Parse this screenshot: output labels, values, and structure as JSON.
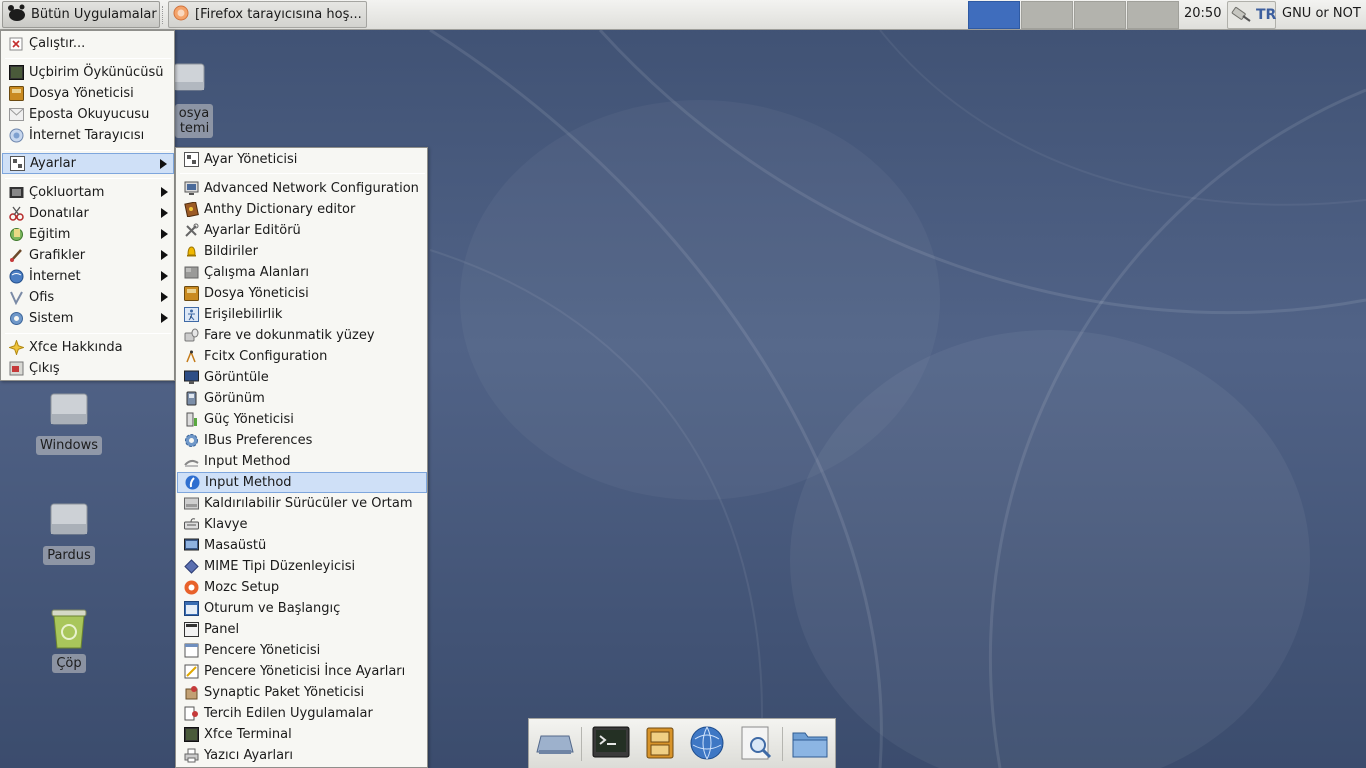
{
  "top_panel": {
    "apps_button": "Bütün Uygulamalar",
    "task_title": "[Firefox tarayıcısına hoş...",
    "clock": "20:50",
    "keyboard_layout": "TR",
    "user": "GNU or NOT"
  },
  "desktop_icons": {
    "file_system": "osya\ntemi",
    "windows": "Windows",
    "pardus": "Pardus",
    "trash": "Çöp"
  },
  "main_menu": {
    "run": "Çalıştır...",
    "terminal": "Uçbirim Öykünücüsü",
    "file_manager": "Dosya Yöneticisi",
    "mail": "Eposta Okuyucusu",
    "browser": "İnternet Tarayıcısı",
    "settings": "Ayarlar",
    "multimedia": "Çokluortam",
    "accessories": "Donatılar",
    "education": "Eğitim",
    "graphics": "Grafikler",
    "internet": "İnternet",
    "office": "Ofis",
    "system": "Sistem",
    "about": "Xfce Hakkında",
    "logout": "Çıkış"
  },
  "settings_menu": {
    "manager": "Ayar Yöneticisi",
    "items": [
      {
        "label": "Advanced Network Configuration",
        "icon": "network-icon"
      },
      {
        "label": "Anthy Dictionary editor",
        "icon": "dictionary-icon"
      },
      {
        "label": "Ayarlar Editörü",
        "icon": "tools-icon"
      },
      {
        "label": "Bildiriler",
        "icon": "bell-icon"
      },
      {
        "label": "Çalışma Alanları",
        "icon": "workspaces-icon"
      },
      {
        "label": "Dosya Yöneticisi",
        "icon": "file-cabinet-icon"
      },
      {
        "label": "Erişilebilirlik",
        "icon": "accessibility-icon"
      },
      {
        "label": "Fare ve dokunmatik yüzey",
        "icon": "mouse-icon"
      },
      {
        "label": "Fcitx Configuration",
        "icon": "fcitx-icon"
      },
      {
        "label": "Görüntüle",
        "icon": "monitor-icon"
      },
      {
        "label": "Görünüm",
        "icon": "appearance-icon"
      },
      {
        "label": "Güç Yöneticisi",
        "icon": "power-icon"
      },
      {
        "label": "IBus Preferences",
        "icon": "gear-icon"
      },
      {
        "label": "Input Method",
        "icon": "keyboard-input-icon"
      },
      {
        "label": "Input Method",
        "icon": "input-method-icon"
      },
      {
        "label": "Kaldırılabilir Sürücüler ve Ortam",
        "icon": "drive-icon"
      },
      {
        "label": "Klavye",
        "icon": "keyboard-icon"
      },
      {
        "label": "Masaüstü",
        "icon": "desktop-icon"
      },
      {
        "label": "MIME Tipi Düzenleyicisi",
        "icon": "mime-icon"
      },
      {
        "label": "Mozc Setup",
        "icon": "mozc-icon"
      },
      {
        "label": "Oturum ve Başlangıç",
        "icon": "session-icon"
      },
      {
        "label": "Panel",
        "icon": "panel-icon"
      },
      {
        "label": "Pencere Yöneticisi",
        "icon": "window-icon"
      },
      {
        "label": "Pencere Yöneticisi İnce Ayarları",
        "icon": "window-tweaks-icon"
      },
      {
        "label": "Synaptic Paket Yöneticisi",
        "icon": "package-icon"
      },
      {
        "label": "Tercih Edilen Uygulamalar",
        "icon": "preferred-apps-icon"
      },
      {
        "label": "Xfce Terminal",
        "icon": "terminal-icon"
      },
      {
        "label": "Yazıcı Ayarları",
        "icon": "printer-icon"
      }
    ]
  },
  "colors": {
    "selection": "#cfe0f7",
    "selection_border": "#7ea6dd",
    "workspace_active": "#3f6dbd"
  }
}
